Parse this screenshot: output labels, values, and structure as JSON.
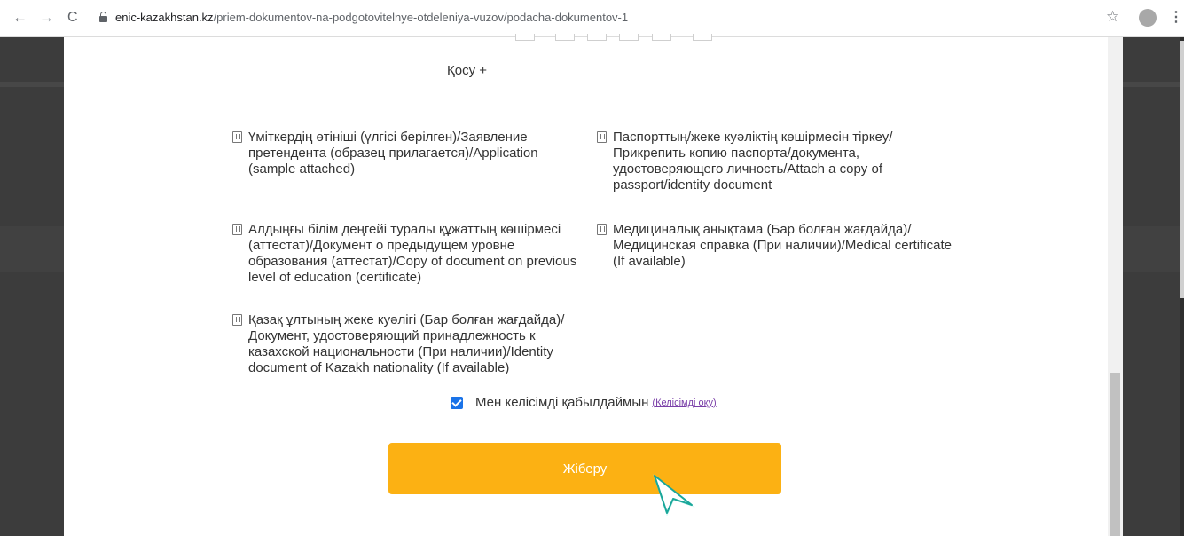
{
  "browser": {
    "url_host": "enic-kazakhstan.kz",
    "url_path": "/priem-dokumentov-na-podgotovitelnye-otdeleniya-vuzov/podacha-dokumentov-1",
    "back_icon": "←",
    "forward_icon": "→",
    "reload_icon": "C",
    "star_icon": "☆",
    "menu_icon": "⋮"
  },
  "form": {
    "add_label": "Қосу +",
    "documents": [
      {
        "text": "Үміткердің өтініші (үлгісі берілген)/Заявление претендента (образец прилагается)/Application (sample attached)"
      },
      {
        "text": "Паспорттың/жеке куәліктің көшірмесін тіркеу/ Прикрепить копию паспорта/документа, удостоверяющего личность/Attach a copy of passport/identity document"
      },
      {
        "text": "Алдыңғы білім деңгейі туралы құжаттың көшірмесі (аттестат)/Документ о предыдущем уровне образования (аттестат)/Copy of document on previous level of education (certificate)"
      },
      {
        "text": "Медициналық анықтама (Бар болған жағдайда)/ Медицинская справка (При наличии)/Medical certificate (If available)"
      },
      {
        "text": "Қазақ ұлтының жеке куәлігі (Бар болған жағдайда)/Документ, удостоверяющий принадлежность к казахской национальности (При наличии)/Identity document of Kazakh nationality (If available)"
      }
    ],
    "consent_label": "Мен келісімді қабылдаймын",
    "consent_checked": true,
    "consent_link": "(Келісімді оқу)",
    "submit_label": "Жіберу"
  },
  "colors": {
    "submit_bg": "#fcb113",
    "checkbox": "#1a73e8",
    "link": "#7a3fa8"
  }
}
